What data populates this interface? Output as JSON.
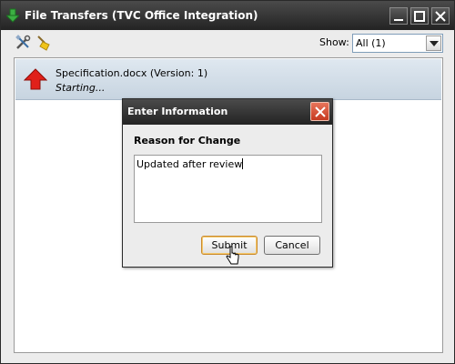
{
  "window": {
    "title": "File Transfers (TVC Office Integration)",
    "app_icon": "download-arrow-icon"
  },
  "toolbar": {
    "icons": [
      "tools-icon",
      "broom-icon"
    ],
    "show_label": "Show:",
    "show_value": "All (1)"
  },
  "transfers": [
    {
      "direction_icon": "upload-arrow-icon",
      "filename": "Specification.docx (Version: 1)",
      "status": "Starting..."
    }
  ],
  "dialog": {
    "title": "Enter Information",
    "label": "Reason for Change",
    "text_value": "Updated after review",
    "submit_label": "Submit",
    "cancel_label": "Cancel"
  },
  "colors": {
    "titlebar": "#2e2e2e",
    "selected_row": "#d4dfe9",
    "upload_arrow": "#e0201a",
    "dialog_close": "#d8492e"
  }
}
